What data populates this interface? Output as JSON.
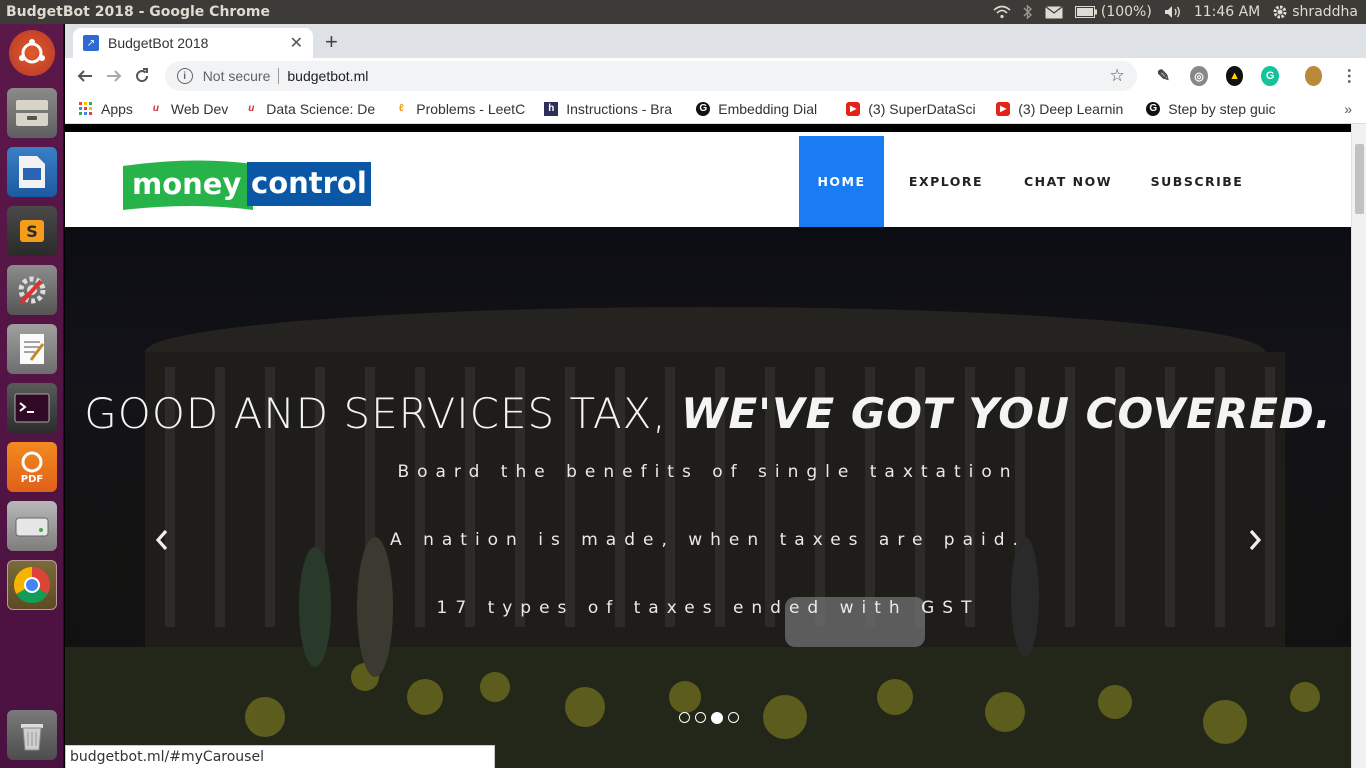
{
  "window_title": "BudgetBot 2018 - Google Chrome",
  "panel": {
    "battery": "(100%)",
    "time": "11:46 AM",
    "user": "shraddha"
  },
  "launcher": {
    "items": [
      "ubuntu-dash",
      "files",
      "libreoffice-impress",
      "sublime-text",
      "system-settings",
      "text-editor",
      "terminal",
      "foxit-pdf",
      "disk-utility",
      "chrome",
      "trash"
    ]
  },
  "tab": {
    "title": "BudgetBot 2018"
  },
  "omnibox": {
    "security": "Not secure",
    "url": "budgetbot.ml"
  },
  "bookmarks": [
    {
      "label": "Apps"
    },
    {
      "label": "Web Dev"
    },
    {
      "label": "Data Science: De"
    },
    {
      "label": "Problems - LeetC"
    },
    {
      "label": "Instructions - Bra"
    },
    {
      "label": "Embedding Dial"
    },
    {
      "label": "(3) SuperDataSci"
    },
    {
      "label": "(3) Deep Learnin"
    },
    {
      "label": "Step by step guic"
    }
  ],
  "site": {
    "logo_left": "money",
    "logo_right": "control",
    "nav": [
      {
        "label": "HOME"
      },
      {
        "label": "EXPLORE"
      },
      {
        "label": "CHAT NOW"
      },
      {
        "label": "SUBSCRIBE"
      }
    ],
    "hero": {
      "headline_plain": "GOOD AND SERVICES TAX, ",
      "headline_bold": "WE'VE GOT YOU COVERED.",
      "line1": "Board the benefits of single taxtation",
      "line2": "A nation is made, when taxes are paid.",
      "line3": "17 types of taxes ended with GST",
      "active_slide": 3,
      "slide_count": 4
    }
  },
  "status_url": "budgetbot.ml/#myCarousel",
  "colors": {
    "nav_active": "#1a7cf2",
    "logo_green": "#27b24a",
    "logo_blue": "#0a57a6"
  }
}
